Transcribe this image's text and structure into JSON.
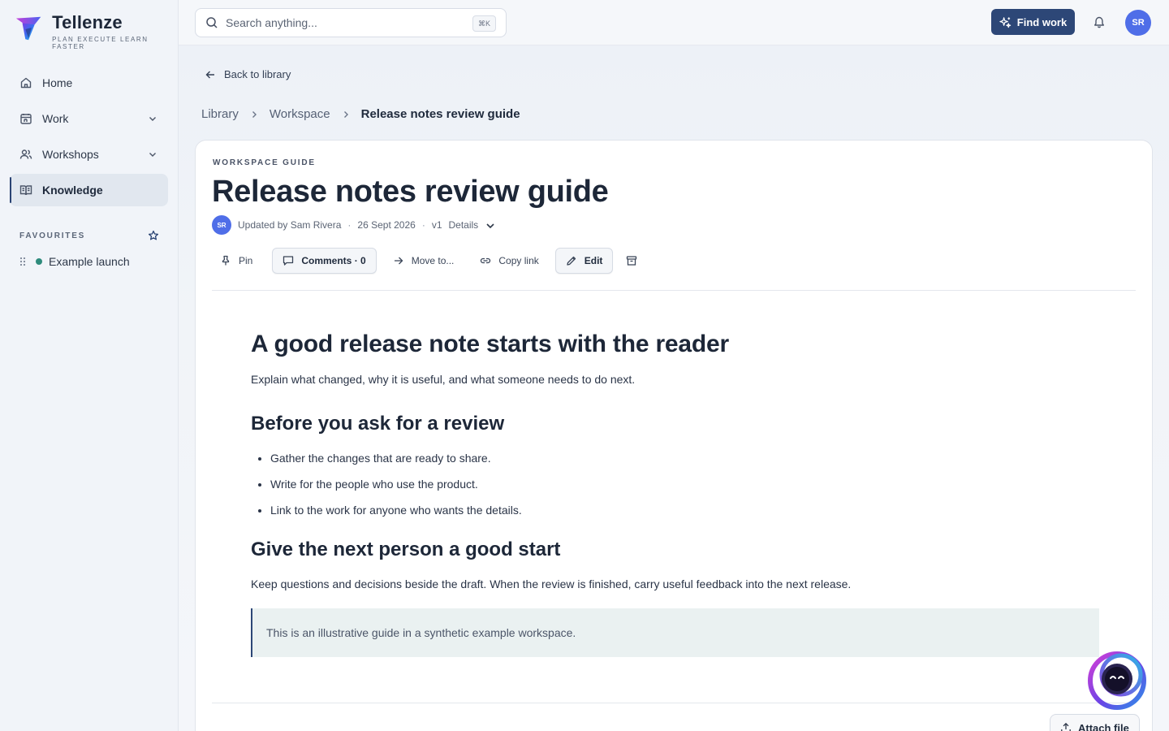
{
  "brand": {
    "name": "Tellenze",
    "tagline": "PLAN EXECUTE LEARN FASTER"
  },
  "sidebar": {
    "items": [
      {
        "label": "Home",
        "icon": "home-icon"
      },
      {
        "label": "Work",
        "icon": "calendar-icon",
        "expandable": true
      },
      {
        "label": "Workshops",
        "icon": "users-icon",
        "expandable": true
      },
      {
        "label": "Knowledge",
        "icon": "book-open-icon",
        "active": true
      }
    ],
    "favourites_title": "FAVOURITES",
    "favourites": [
      {
        "label": "Example launch",
        "color": "#2e8b7c"
      }
    ]
  },
  "topbar": {
    "search_placeholder": "Search anything...",
    "search_shortcut": "⌘K",
    "find_work": "Find work",
    "user_initials": "SR"
  },
  "page": {
    "back_label": "Back to library",
    "breadcrumbs": [
      "Library",
      "Workspace",
      "Release notes review guide"
    ],
    "eyebrow": "WORKSPACE GUIDE",
    "title": "Release notes review guide",
    "meta": {
      "author_initials": "SR",
      "updated_by": "Updated by Sam Rivera",
      "date": "26 Sept 2026",
      "version": "v1",
      "details_label": "Details"
    },
    "toolbar": {
      "pin": "Pin",
      "comments": "Comments · 0",
      "move": "Move to...",
      "copy_link": "Copy link",
      "edit": "Edit"
    },
    "attach_label": "Attach file"
  },
  "article": {
    "heading": "A good release note starts with the reader",
    "intro": "Explain what changed, why it is useful, and what someone needs to do next.",
    "section1_title": "Before you ask for a review",
    "section1_items": [
      "Gather the changes that are ready to share.",
      "Write for the people who use the product.",
      "Link to the work for anyone who wants the details."
    ],
    "section2_title": "Give the next person a good start",
    "section2_text": "Keep questions and decisions beside the draft. When the review is finished, carry useful feedback into the next release.",
    "callout": "This is an illustrative guide in a synthetic example workspace."
  },
  "colors": {
    "accent": "#2d4777",
    "avatar": "#4f6ee8",
    "favourite_dot": "#2e8b7c"
  }
}
